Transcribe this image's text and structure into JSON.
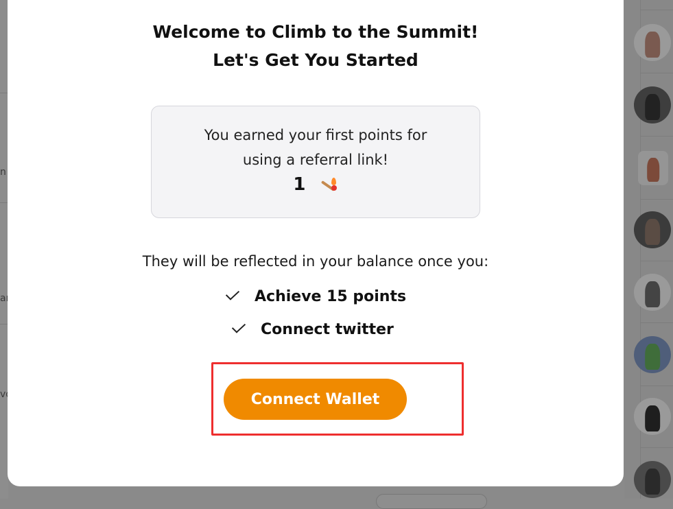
{
  "modal": {
    "title_line1": "Welcome to Climb to the Summit!",
    "title_line2": "Let's Get You Started",
    "info": {
      "line1": "You earned your first points for",
      "line2": "using a referral link!",
      "points": "1",
      "points_icon": "matchstick-icon"
    },
    "reflect_text": "They will be reflected in your balance once you:",
    "requirements": [
      {
        "label": "Achieve 15 points",
        "icon": "check-icon"
      },
      {
        "label": "Connect twitter",
        "icon": "check-icon"
      }
    ],
    "connect_button_label": "Connect Wallet"
  },
  "background": {
    "left_peeks": [
      "n",
      "ar",
      "vo"
    ]
  },
  "colors": {
    "accent": "#f08a00",
    "highlight": "#ee2e2e",
    "info_box_bg": "#f4f4f6"
  }
}
